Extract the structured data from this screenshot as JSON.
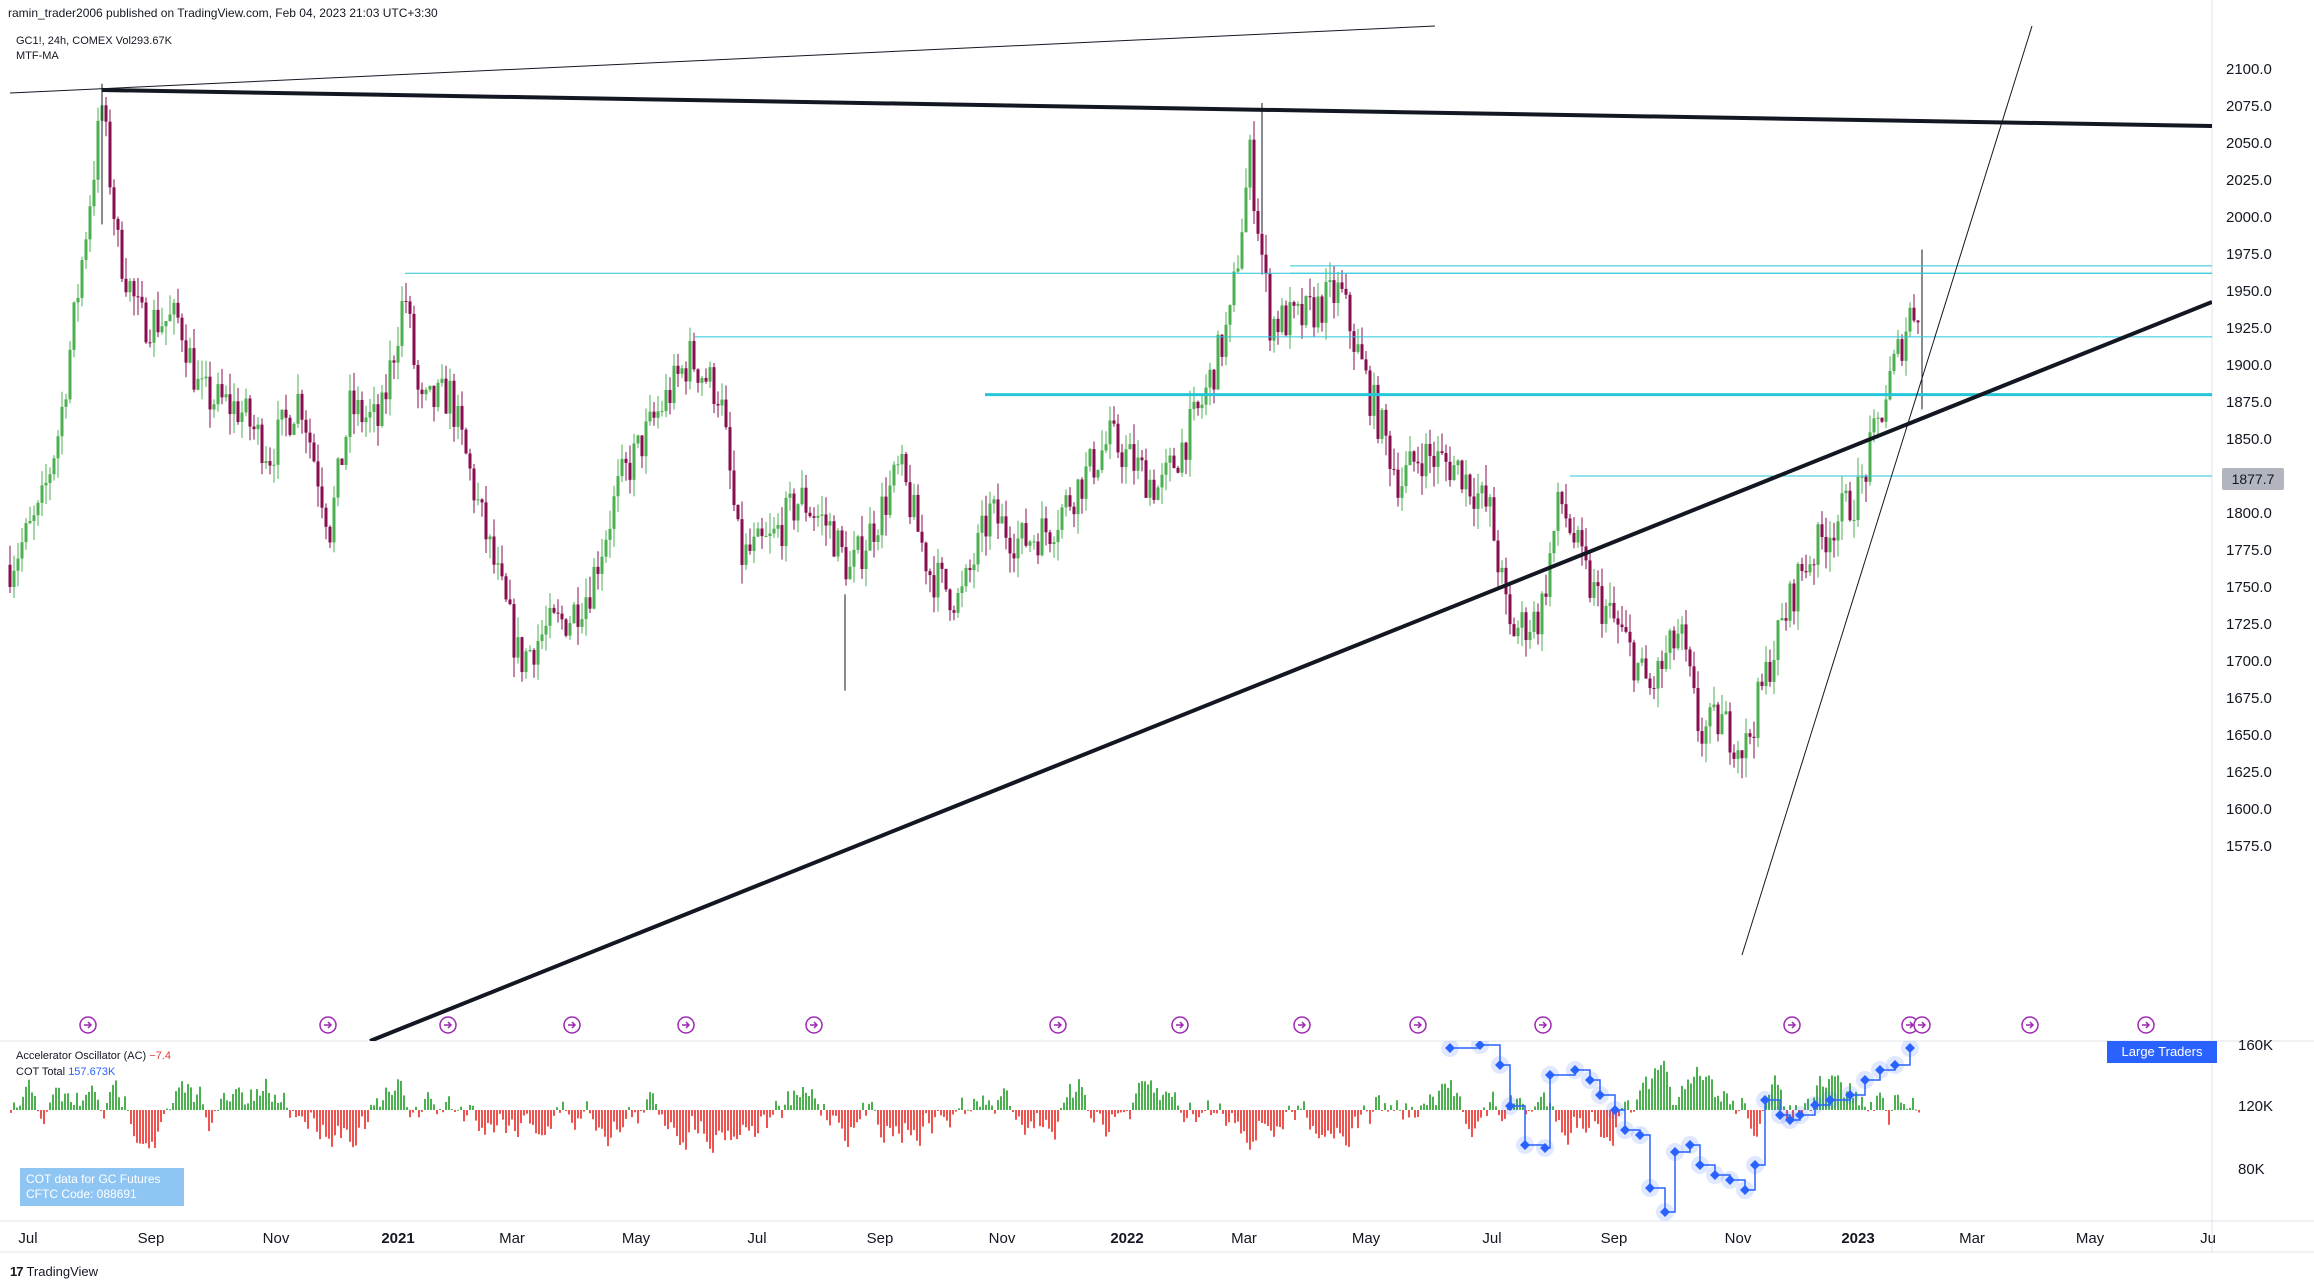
{
  "header": {
    "published_line": "ramin_trader2006 published on TradingView.com, Feb 04, 2023 21:03 UTC+3:30"
  },
  "legend": {
    "symbol_line": "GC1!, 24h, COMEX  Vol293.67K",
    "indicator_line": "MTF-MA"
  },
  "oscillator": {
    "name": "Accelerator Oscillator (AC)",
    "value": "−7.4",
    "cot_label": "COT Total",
    "cot_value": "157.673K"
  },
  "cot_box": {
    "line1": "COT data for GC Futures",
    "line2": "CFTC Code: 088691"
  },
  "large_traders_badge": "Large Traders",
  "last_price": "1877.7",
  "price_axis": [
    "2100.0",
    "2075.0",
    "2050.0",
    "2025.0",
    "2000.0",
    "1975.0",
    "1950.0",
    "1925.0",
    "1900.0",
    "1875.0",
    "1850.0",
    "1825.0",
    "1800.0",
    "1775.0",
    "1750.0",
    "1725.0",
    "1700.0",
    "1675.0",
    "1650.0",
    "1625.0",
    "1600.0",
    "1575.0"
  ],
  "osc_axis": [
    "160K",
    "120K",
    "80K"
  ],
  "time_axis": [
    {
      "label": "Jul",
      "bold": false
    },
    {
      "label": "Sep",
      "bold": false
    },
    {
      "label": "Nov",
      "bold": false
    },
    {
      "label": "2021",
      "bold": true
    },
    {
      "label": "Mar",
      "bold": false
    },
    {
      "label": "May",
      "bold": false
    },
    {
      "label": "Jul",
      "bold": false
    },
    {
      "label": "Sep",
      "bold": false
    },
    {
      "label": "Nov",
      "bold": false
    },
    {
      "label": "2022",
      "bold": true
    },
    {
      "label": "Mar",
      "bold": false
    },
    {
      "label": "May",
      "bold": false
    },
    {
      "label": "Jul",
      "bold": false
    },
    {
      "label": "Sep",
      "bold": false
    },
    {
      "label": "Nov",
      "bold": false
    },
    {
      "label": "2023",
      "bold": true
    },
    {
      "label": "Mar",
      "bold": false
    },
    {
      "label": "May",
      "bold": false
    },
    {
      "label": "Ju",
      "bold": false
    }
  ],
  "footer": {
    "logo_glyph": "17",
    "brand": "TradingView"
  },
  "colors": {
    "up_candle": "#4caf50",
    "down_candle": "#880e4f",
    "trendline": "#131722",
    "level_line": "#26c6da",
    "osc_up": "#4caf50",
    "osc_down": "#ef5350",
    "cot_line": "#2962ff",
    "event_marker": "#9c27b0"
  },
  "icons": [
    "event-arrow-icon",
    "tradingview-logo-icon"
  ]
}
